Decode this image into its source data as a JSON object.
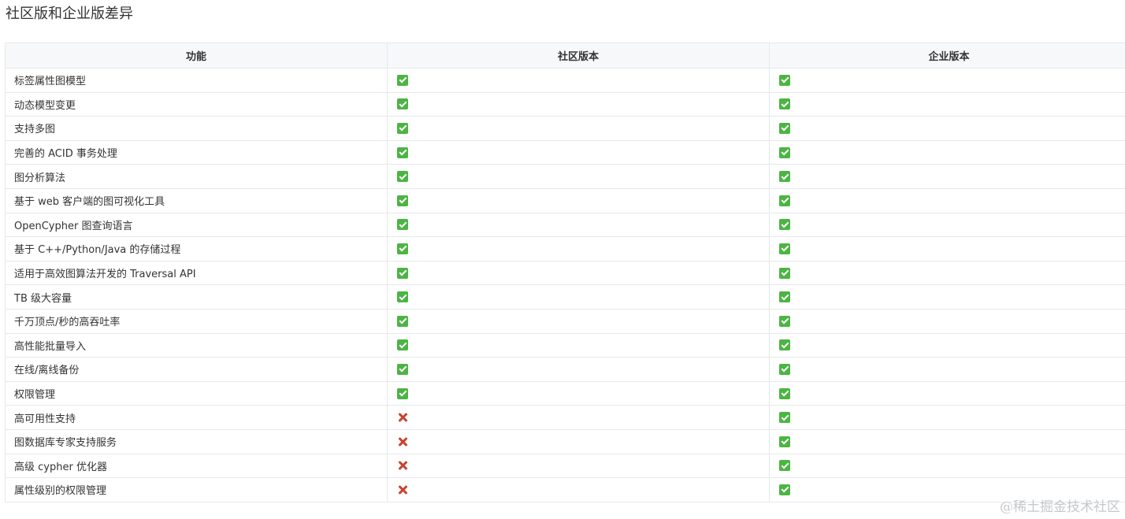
{
  "page": {
    "title": "社区版和企业版差异"
  },
  "table": {
    "headers": [
      "功能",
      "社区版本",
      "企业版本"
    ],
    "rows": [
      {
        "feature": "标签属性图模型",
        "community": "check",
        "enterprise": "check"
      },
      {
        "feature": "动态模型变更",
        "community": "check",
        "enterprise": "check"
      },
      {
        "feature": "支持多图",
        "community": "check",
        "enterprise": "check"
      },
      {
        "feature": "完善的 ACID 事务处理",
        "community": "check",
        "enterprise": "check"
      },
      {
        "feature": "图分析算法",
        "community": "check",
        "enterprise": "check"
      },
      {
        "feature": "基于 web 客户端的图可视化工具",
        "community": "check",
        "enterprise": "check"
      },
      {
        "feature": "OpenCypher 图查询语言",
        "community": "check",
        "enterprise": "check"
      },
      {
        "feature": "基于 C++/Python/Java 的存储过程",
        "community": "check",
        "enterprise": "check"
      },
      {
        "feature": "适用于高效图算法开发的 Traversal API",
        "community": "check",
        "enterprise": "check"
      },
      {
        "feature": "TB 级大容量",
        "community": "check",
        "enterprise": "check"
      },
      {
        "feature": "千万顶点/秒的高吞吐率",
        "community": "check",
        "enterprise": "check"
      },
      {
        "feature": "高性能批量导入",
        "community": "check",
        "enterprise": "check"
      },
      {
        "feature": "在线/离线备份",
        "community": "check",
        "enterprise": "check"
      },
      {
        "feature": "权限管理",
        "community": "check",
        "enterprise": "check"
      },
      {
        "feature": "高可用性支持",
        "community": "cross",
        "enterprise": "check"
      },
      {
        "feature": "图数据库专家支持服务",
        "community": "cross",
        "enterprise": "check"
      },
      {
        "feature": "高级 cypher 优化器",
        "community": "cross",
        "enterprise": "check"
      },
      {
        "feature": "属性级别的权限管理",
        "community": "cross",
        "enterprise": "check"
      }
    ]
  },
  "icons": {
    "check": "check-mark-icon",
    "cross": "cross-mark-icon"
  },
  "colors": {
    "check_green": "#4bb543",
    "cross_red": "#c9432f",
    "header_bg": "#f7f8fa",
    "border": "#e6e8eb"
  },
  "watermark": "@稀土掘金技术社区"
}
